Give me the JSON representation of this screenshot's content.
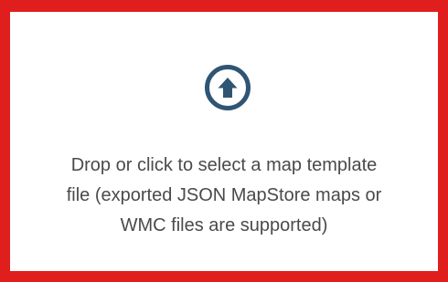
{
  "dropzone": {
    "icon": "upload-arrow-circle-icon",
    "lines": [
      "Drop or click to select a map template",
      "file (exported JSON MapStore maps or",
      "WMC files are supported)"
    ]
  },
  "colors": {
    "frame": "#e01e1e",
    "icon": "#2f5573",
    "text": "#4a4a4a",
    "background": "#ffffff"
  }
}
